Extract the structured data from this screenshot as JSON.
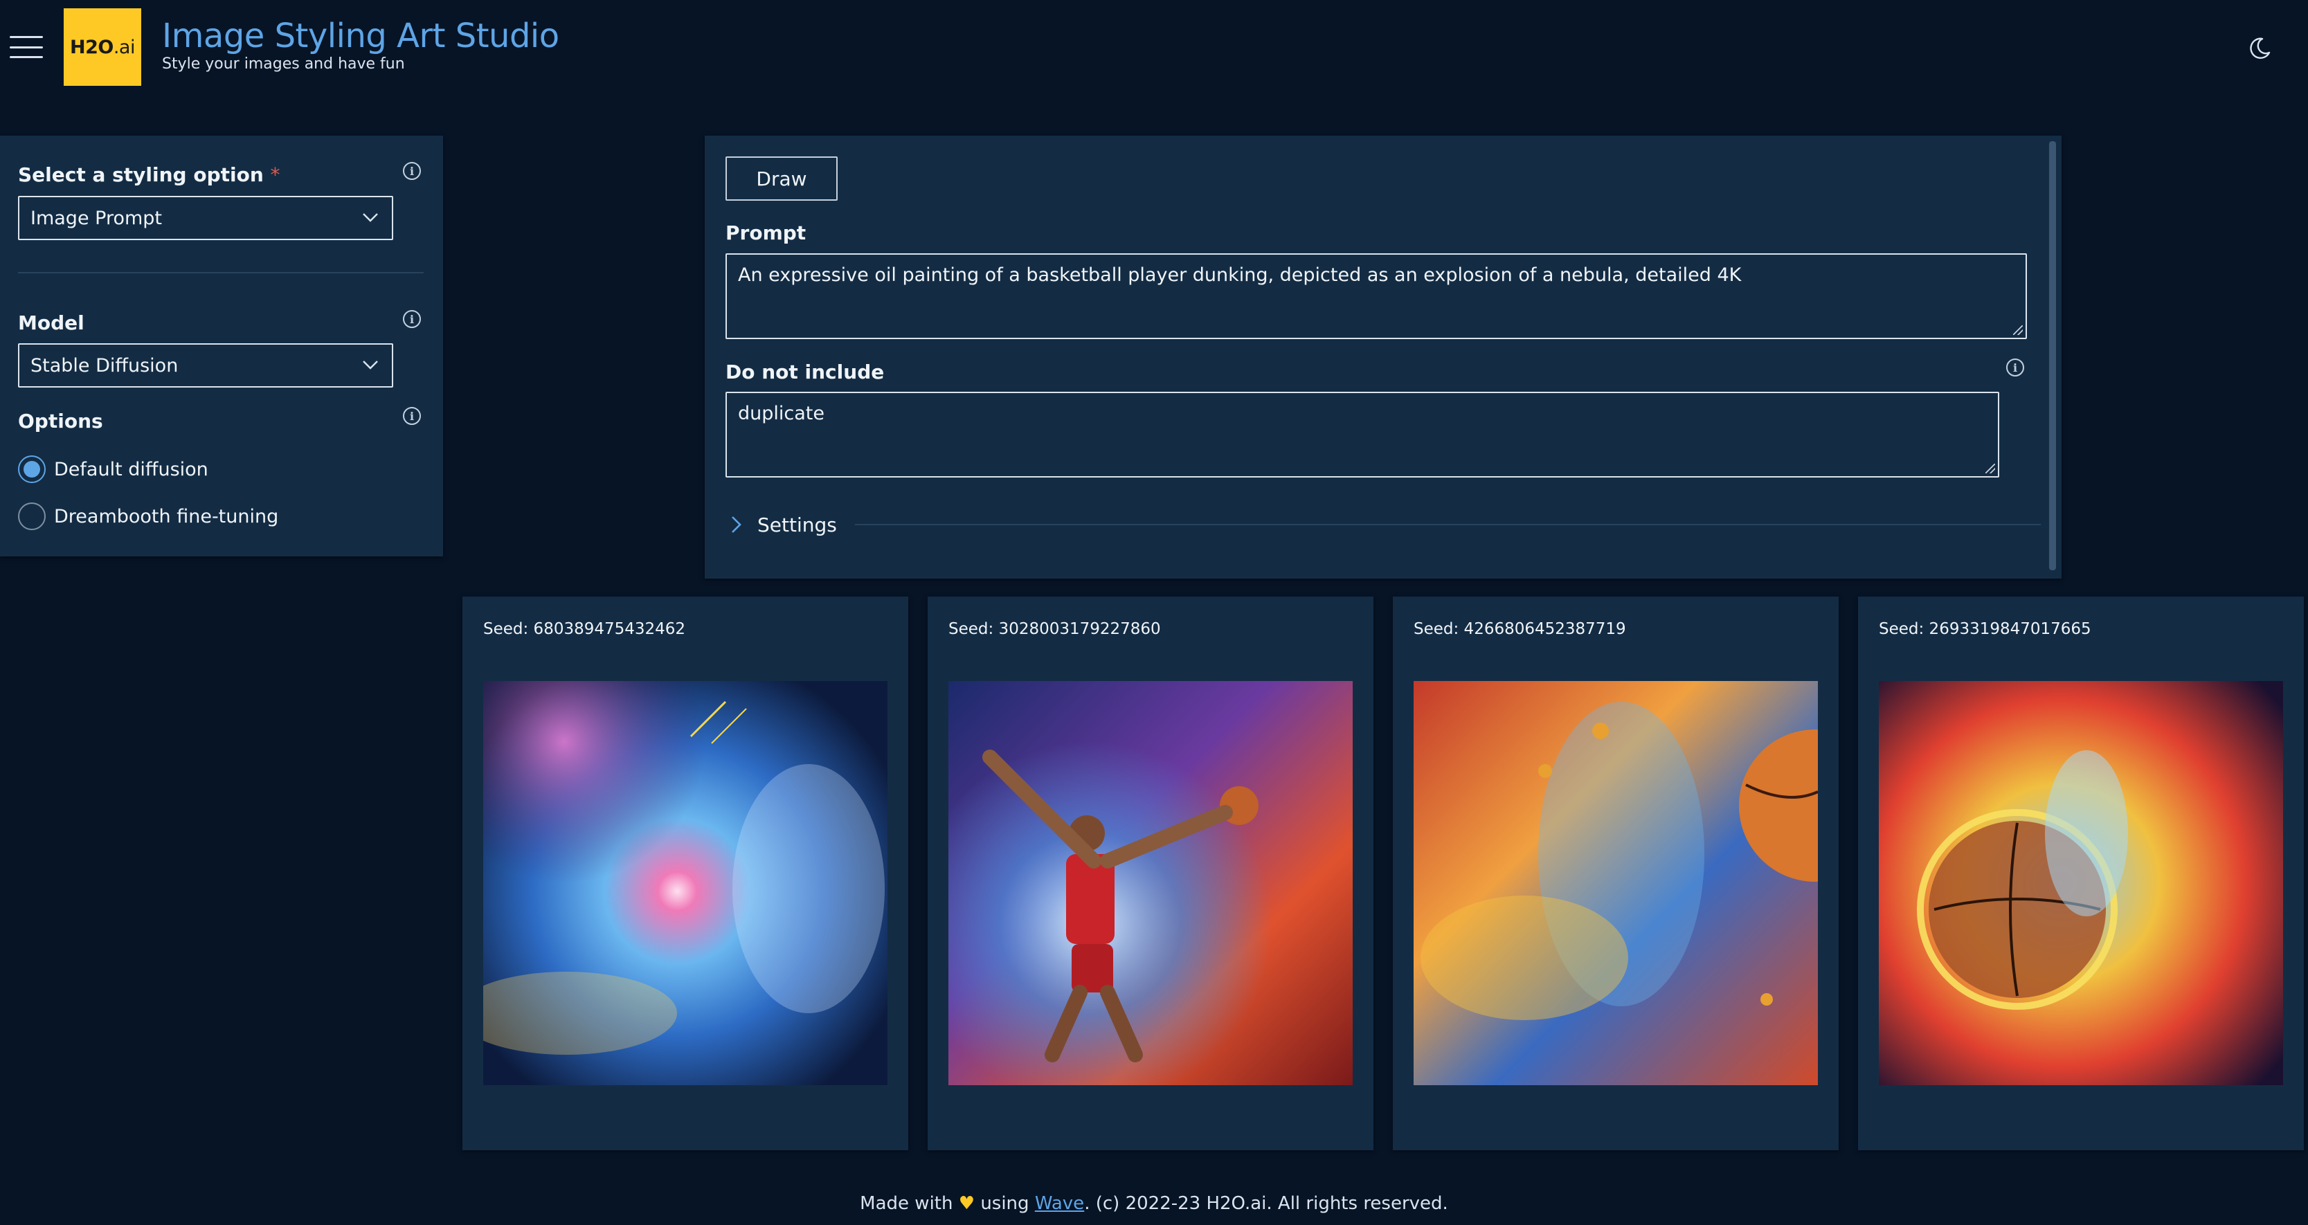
{
  "header": {
    "logo_text_main": "H2O",
    "logo_text_suffix": ".ai",
    "title": "Image Styling Art Studio",
    "subtitle": "Style your images and have fun",
    "menu_icon": "hamburger-menu-icon",
    "theme_icon": "moon-icon"
  },
  "sidebar": {
    "styling_label": "Select a styling option",
    "required_mark": "*",
    "styling_value": "Image Prompt",
    "model_label": "Model",
    "model_value": "Stable Diffusion",
    "options_label": "Options",
    "options": [
      {
        "label": "Default diffusion",
        "checked": true
      },
      {
        "label": "Dreambooth fine-tuning",
        "checked": false
      }
    ]
  },
  "form": {
    "draw_label": "Draw",
    "prompt_label": "Prompt",
    "prompt_value": "An expressive oil painting of a basketball player dunking, depicted as an explosion of a nebula, detailed 4K",
    "negative_label": "Do not include",
    "negative_value": "duplicate",
    "settings_label": "Settings"
  },
  "results": [
    {
      "seed": "Seed: 680389475432462"
    },
    {
      "seed": "Seed: 3028003179227860"
    },
    {
      "seed": "Seed: 4266806452387719"
    },
    {
      "seed": "Seed: 2693319847017665"
    }
  ],
  "footer": {
    "made_with": "Made with",
    "using": "using",
    "link": "Wave",
    "rest": ". (c) 2022-23 H2O.ai. All rights reserved."
  },
  "colors": {
    "background": "#071426",
    "card": "#132c44",
    "accent": "#5ea5e6",
    "logo": "#fec925"
  }
}
